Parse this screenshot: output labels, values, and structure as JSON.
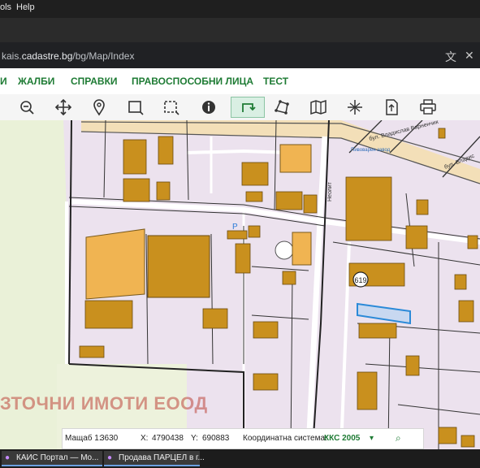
{
  "menu": {
    "tools_label": "ols",
    "help_label": "Help"
  },
  "address": {
    "url_prefix": "kais.",
    "url_host": "cadastre.bg",
    "url_path": "/bg/Map/Index",
    "translate_icon": "translate-icon",
    "close_icon": "close-icon"
  },
  "nav": {
    "items": [
      "И",
      "ЖАЛБИ",
      "СПРАВКИ",
      "ПРАВОСПОСОБНИ ЛИЦА",
      "ТЕСТ"
    ]
  },
  "toolbar": {
    "tools": [
      "zoom-out-icon",
      "pan-icon",
      "location-pin-icon",
      "select-rectangle-icon",
      "select-area-icon",
      "info-icon",
      "routing-icon",
      "polygon-icon",
      "map-icon",
      "cross-section-icon",
      "export-icon",
      "print-icon"
    ],
    "active_tool": "routing-icon"
  },
  "map": {
    "labels": {
      "street_top": "бул. Владислав Варненчик",
      "street_right": "бул. Владис",
      "street_vertical": "Неолит",
      "parking_1": "P",
      "parking_2": "P",
      "landmark": "Пивоварен завод",
      "plot_number": "619",
      "watermark": "ЗТОЧНИ ИМОТИ ЕООД"
    },
    "colors": {
      "background": "#ece2ee",
      "building": "#c9901e",
      "building_large": "#f0b452",
      "selected_plot": "#2b8ad8",
      "green_area": "#e9f0d6"
    }
  },
  "status": {
    "scale_label": "Мащаб 1:",
    "scale_value": "3630",
    "x_label": "X:",
    "x_value": "4790438",
    "y_label": "Y:",
    "y_value": "690883",
    "crs_label": "Координатна система:",
    "crs_value": "ККС 2005"
  },
  "taskbar": {
    "items": [
      "КАИС Портал — Mo...",
      "Продава ПАРЦЕЛ в г..."
    ]
  }
}
